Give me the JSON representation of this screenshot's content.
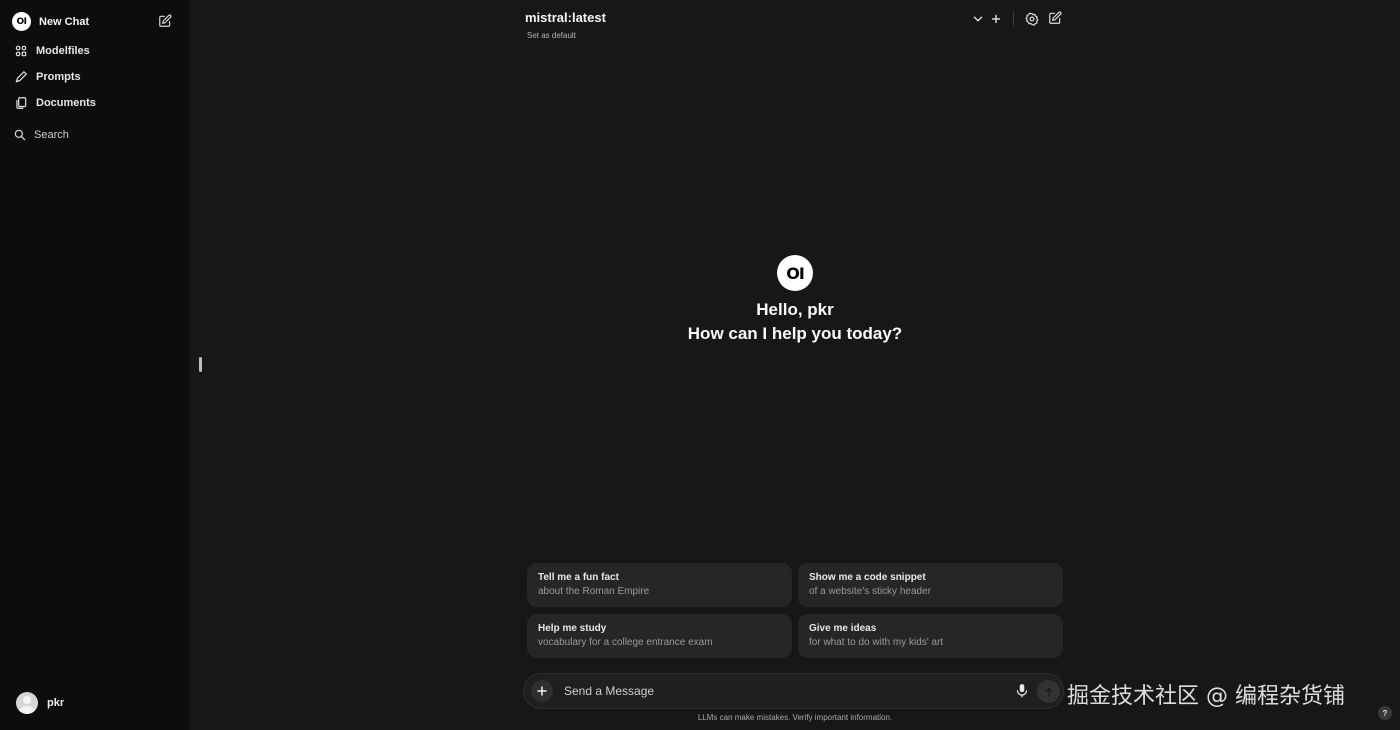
{
  "sidebar": {
    "logo_text": "OI",
    "new_chat_label": "New Chat",
    "items": [
      {
        "label": "Modelfiles",
        "icon": "grid-icon"
      },
      {
        "label": "Prompts",
        "icon": "pencil-icon"
      },
      {
        "label": "Documents",
        "icon": "documents-icon"
      }
    ],
    "search_label": "Search",
    "user_name": "pkr"
  },
  "header": {
    "model_name": "mistral:latest",
    "set_default_label": "Set as default"
  },
  "greeting": {
    "logo_text": "OI",
    "line1": "Hello, pkr",
    "line2": "How can I help you today?"
  },
  "suggestions": [
    {
      "title": "Tell me a fun fact",
      "subtitle": "about the Roman Empire"
    },
    {
      "title": "Show me a code snippet",
      "subtitle": "of a website's sticky header"
    },
    {
      "title": "Help me study",
      "subtitle": "vocabulary for a college entrance exam"
    },
    {
      "title": "Give me ideas",
      "subtitle": "for what to do with my kids' art"
    }
  ],
  "input": {
    "placeholder": "Send a Message"
  },
  "footer": {
    "disclaimer": "LLMs can make mistakes. Verify important information.",
    "watermark": "掘金技术社区 @ 编程杂货铺",
    "help_label": "?"
  },
  "colors": {
    "background": "#171717",
    "sidebar": "#0d0d0d",
    "card": "#262626",
    "text": "#ececec"
  }
}
